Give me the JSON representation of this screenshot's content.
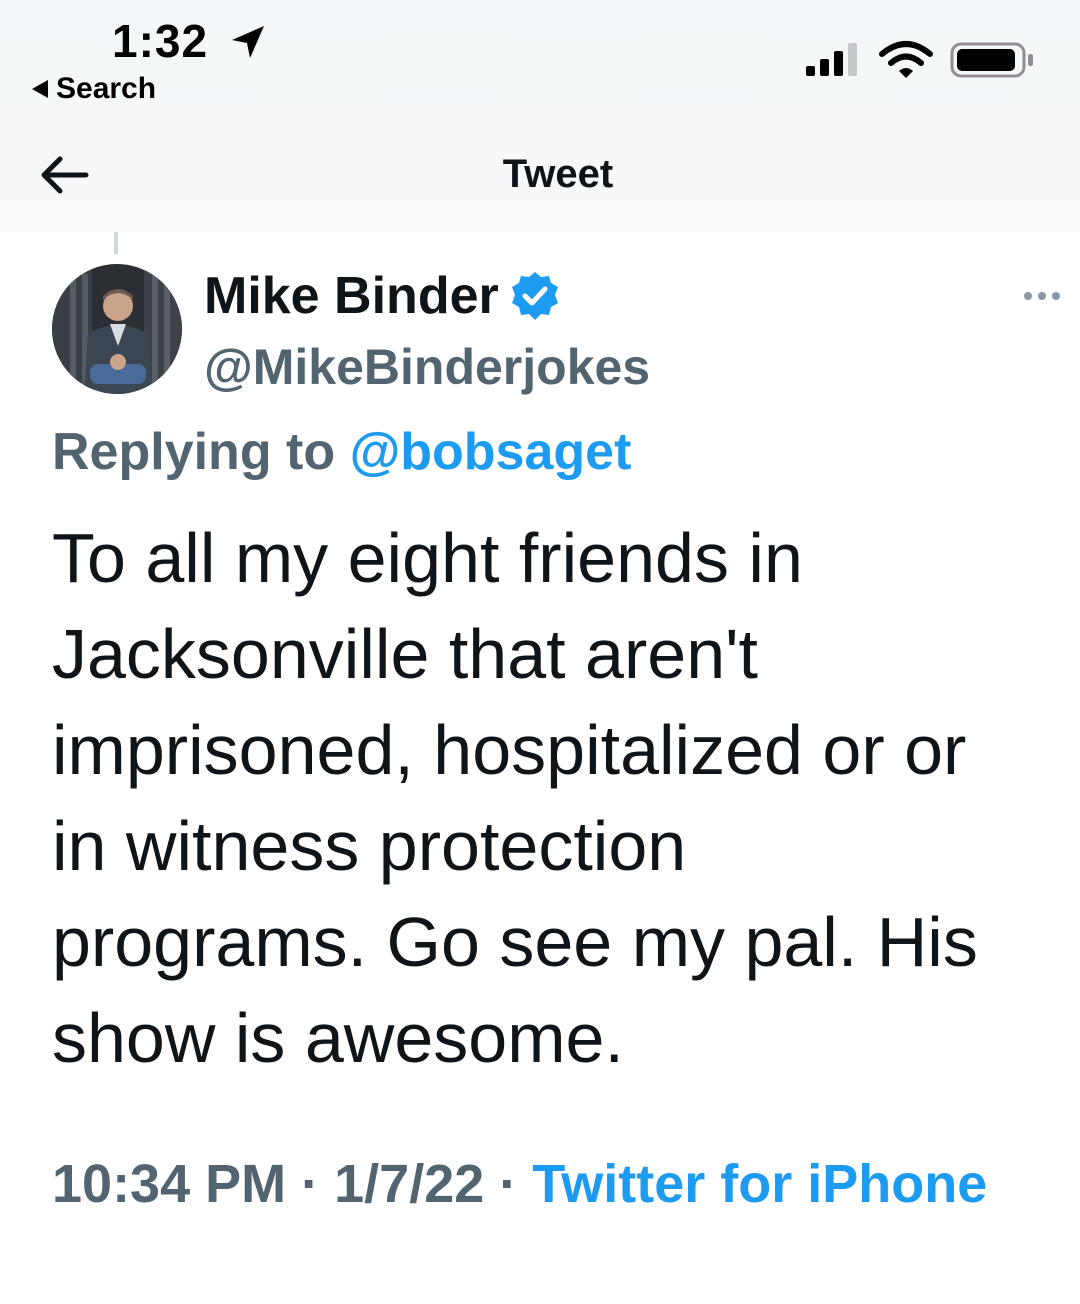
{
  "status_bar": {
    "time": "1:32",
    "back_app_label": "Search",
    "icons": [
      "location-arrow-icon",
      "cellular-signal-icon",
      "wifi-icon",
      "battery-icon"
    ]
  },
  "nav": {
    "title": "Tweet",
    "back_icon": "back-arrow-icon"
  },
  "tweet": {
    "author": {
      "name": "Mike Binder",
      "handle": "@MikeBinderjokes",
      "verified": true,
      "avatar_icon": "avatar-photo"
    },
    "reply": {
      "prefix": "Replying to ",
      "mention": "@bobsaget"
    },
    "text_lines": [
      "To all my eight friends in",
      "Jacksonville that aren't",
      "imprisoned, hospitalized or or",
      "in witness protection",
      "programs. Go see my pal. His",
      "show is awesome."
    ],
    "meta": {
      "time": "10:34 PM",
      "separator": " · ",
      "date": "1/7/22",
      "source": "Twitter for iPhone"
    }
  },
  "colors": {
    "accent": "#1d9bf0",
    "secondary_text": "#536471",
    "primary_text": "#0f1419",
    "header_bg": "#f5f8fa"
  }
}
